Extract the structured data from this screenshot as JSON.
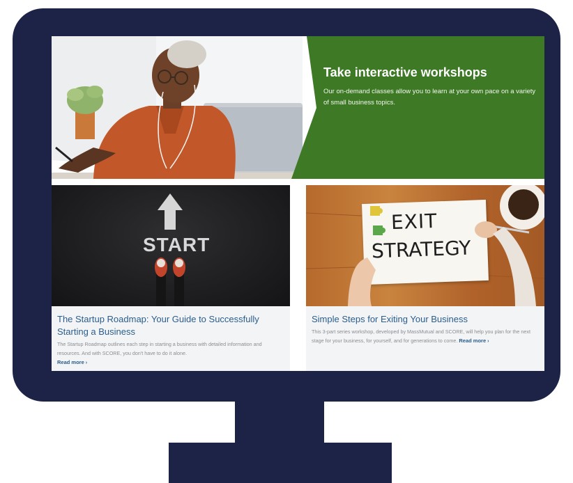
{
  "hero": {
    "title": "Take interactive workshops",
    "description": "Our on-demand classes allow you to learn at your own pace on a variety of small business topics."
  },
  "cards": [
    {
      "image_text": "START",
      "title": "The Startup Roadmap: Your Guide to Successfully Starting a Business",
      "description": "The Startup Roadmap outlines each step in starting a business with detailed information and resources. And with SCORE, you don't have to do it alone.",
      "read_more": "Read more"
    },
    {
      "image_text_line1": "EXIT",
      "image_text_line2": "STRATEGY",
      "title": "Simple Steps for Exiting Your Business",
      "description": "This 3-part series workshop, developed by MassMutual and SCORE, will help you plan for the next stage for your business, for yourself, and for generations to come.",
      "read_more": "Read more"
    }
  ],
  "icons": {
    "read_more_arrow": "chevron-right-icon",
    "arrow_up": "arrow-up-icon"
  },
  "colors": {
    "monitor": "#1d2347",
    "hero_panel": "#3e7a26",
    "link": "#2a5d8c",
    "card_body": "#f3f4f6"
  }
}
